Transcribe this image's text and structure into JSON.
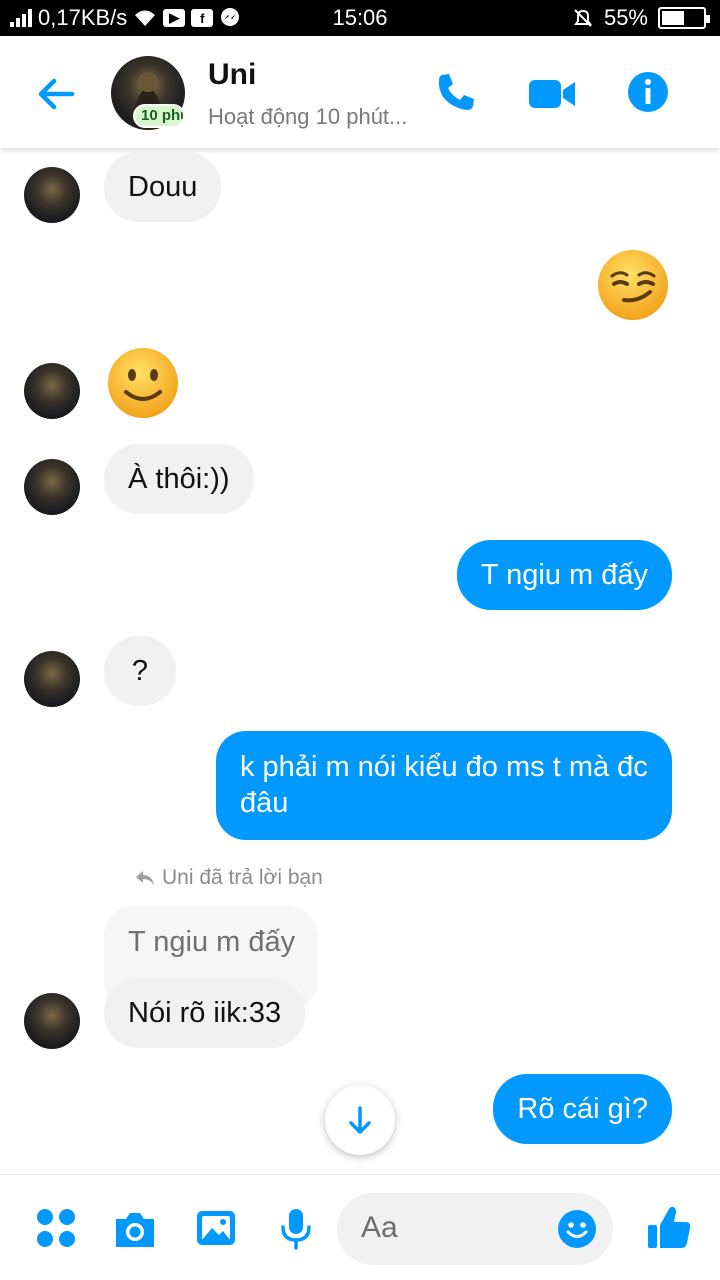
{
  "status_bar": {
    "network_speed": "0,17KB/s",
    "time": "15:06",
    "battery": "55%",
    "battery_level": 0.55
  },
  "header": {
    "back_icon": "arrow-left-icon",
    "contact_name": "Uni",
    "active_badge": "10 phút",
    "activity_status": "Hoạt động 10 phút...",
    "call_icon": "phone-icon",
    "video_icon": "video-camera-icon",
    "info_icon": "info-icon",
    "accent_color": "#0199fe"
  },
  "messages": [
    {
      "side": "in",
      "text": "Douu"
    },
    {
      "side": "out",
      "emoji": "smirking-face"
    },
    {
      "side": "in",
      "emoji": "slightly-smiling-face"
    },
    {
      "side": "in",
      "text": "À thôi:))"
    },
    {
      "side": "out",
      "text": "T ngiu m đấy"
    },
    {
      "side": "in",
      "text": "?"
    },
    {
      "side": "out",
      "text_line1": "k phải m nói kiểu đo ms t mà đc",
      "text_line2": "đâu"
    },
    {
      "side": "note",
      "text": "Uni đã trả lời bạn"
    },
    {
      "side": "quote",
      "text": "T ngiu m đấy"
    },
    {
      "side": "in",
      "text": "Nói rõ iik:33"
    },
    {
      "side": "out",
      "text": "Rõ cái gì?"
    }
  ],
  "composer": {
    "placeholder": "Aa",
    "icons": [
      "apps-grid-icon",
      "camera-icon",
      "gallery-icon",
      "microphone-icon",
      "emoji-icon",
      "thumbs-up-icon"
    ]
  }
}
